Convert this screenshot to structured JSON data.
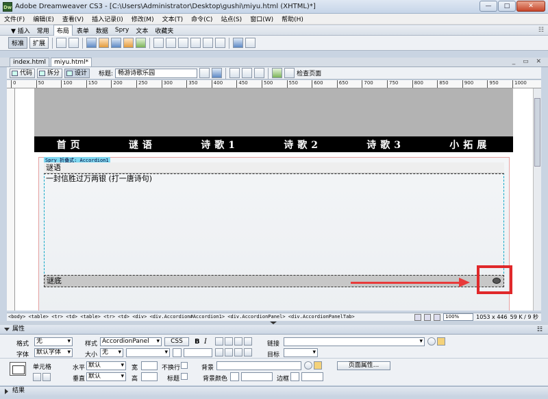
{
  "window": {
    "title": "Adobe Dreamweaver CS3 - [C:\\Users\\Administrator\\Desktop\\gushi\\miyu.html (XHTML)*]",
    "app_icon_text": "Dw",
    "minimize": "—",
    "maximize": "□",
    "close": "✕"
  },
  "menu": [
    "文件(F)",
    "编辑(E)",
    "查看(V)",
    "插入记录(I)",
    "修改(M)",
    "文本(T)",
    "命令(C)",
    "站点(S)",
    "窗口(W)",
    "帮助(H)"
  ],
  "insert_tabs": {
    "items": [
      "▼ 插入",
      "常用",
      "布局",
      "表单",
      "数据",
      "Spry",
      "文本",
      "收藏夹"
    ],
    "active_index": 2,
    "panel_menu": "☷"
  },
  "insert_bar": {
    "standard_label": "标准",
    "expanded_label": "扩展"
  },
  "doc_tabs": {
    "items": [
      "index.html",
      "miyu.html*"
    ],
    "active_index": 1,
    "controls": "_ ▭ ✕"
  },
  "doc_toolbar": {
    "code_label": "代码",
    "split_label": "拆分",
    "design_label": "设计",
    "title_label": "标题:",
    "title_value": "畅游诗歌乐园",
    "check_page_label": "检查页面"
  },
  "ruler": {
    "ticks": [
      "0",
      "50",
      "100",
      "150",
      "200",
      "250",
      "300",
      "350",
      "400",
      "450",
      "500",
      "550",
      "600",
      "650",
      "700",
      "750",
      "800",
      "850",
      "900",
      "950",
      "1000"
    ]
  },
  "page": {
    "nav": [
      "首页",
      "谜语",
      "诗歌1",
      "诗歌2",
      "诗歌3",
      "小拓展"
    ],
    "spry_label": "Spry 折叠式: Accordion1",
    "tab1_label": "谜语",
    "content1_text": "一封信胜过万两银 (打一唐诗句)",
    "tab2_label": "谜底"
  },
  "status": {
    "tag_path": "<body> <table> <tr> <td> <table> <tr> <td> <div> <div.Accordion#Accordion1> <div.AccordionPanel> <div.AccordionPanelTab>",
    "zoom": "100%",
    "dimensions": "1053 x 446",
    "filesize": "59 K / 9 秒"
  },
  "properties": {
    "panel_title": "属性",
    "format_label": "格式",
    "format_value": "无",
    "style_label": "样式",
    "style_value": "AccordionPanel",
    "css_button": "CSS",
    "bold": "B",
    "italic": "I",
    "link_label": "链接",
    "font_label": "字体",
    "font_value": "默认字体",
    "size_label": "大小",
    "size_value": "无",
    "target_label": "目标",
    "cell_label": "单元格",
    "horz_label": "水平",
    "horz_value": "默认",
    "width_label": "宽",
    "nowrap_label": "不换行",
    "bg_label": "背景",
    "page_props_button": "页面属性...",
    "vert_label": "垂直",
    "vert_value": "默认",
    "height_label": "高",
    "header_label": "标题",
    "bgcolor_label": "背景颜色",
    "border_label": "边框"
  },
  "results_panel": {
    "title": "结果"
  }
}
